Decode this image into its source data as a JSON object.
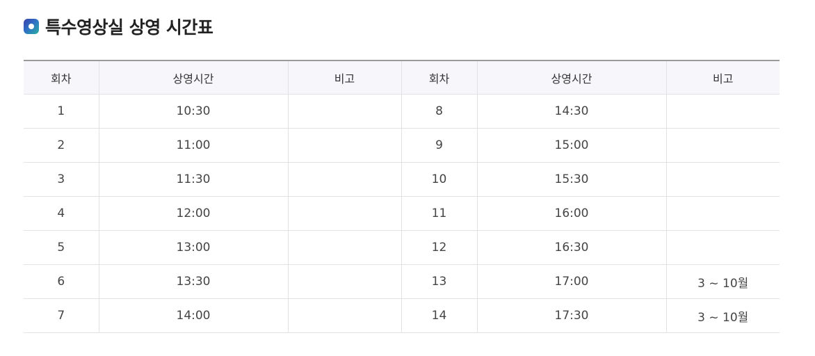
{
  "page": {
    "title": "특수영상실 상영 시간표",
    "title_icon": "rounded-square-dot-icon",
    "accent_colors": [
      "#3a3fa8",
      "#2f6fc6",
      "#27b0a0"
    ]
  },
  "table": {
    "headers": [
      "회차",
      "상영시간",
      "비고",
      "회차",
      "상영시간",
      "비고"
    ],
    "rows": [
      [
        "1",
        "10:30",
        "",
        "8",
        "14:30",
        ""
      ],
      [
        "2",
        "11:00",
        "",
        "9",
        "15:00",
        ""
      ],
      [
        "3",
        "11:30",
        "",
        "10",
        "15:30",
        ""
      ],
      [
        "4",
        "12:00",
        "",
        "11",
        "16:00",
        ""
      ],
      [
        "5",
        "13:00",
        "",
        "12",
        "16:30",
        ""
      ],
      [
        "6",
        "13:30",
        "",
        "13",
        "17:00",
        "3 ~ 10월"
      ],
      [
        "7",
        "14:00",
        "",
        "14",
        "17:30",
        "3 ~ 10월"
      ]
    ]
  }
}
